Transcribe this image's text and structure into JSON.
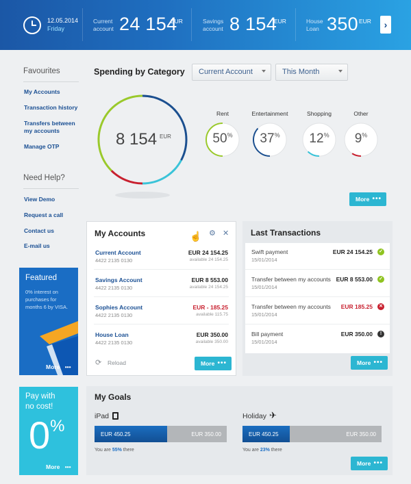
{
  "header": {
    "date": "12.05.2014",
    "day": "Friday",
    "accounts": [
      {
        "label_line1": "Current",
        "label_line2": "account",
        "value": "24 154",
        "currency": "EUR"
      },
      {
        "label_line1": "Savings",
        "label_line2": "account",
        "value": "8 154",
        "currency": "EUR"
      },
      {
        "label_line1": "House",
        "label_line2": "Loan",
        "value": "350",
        "currency": "EUR"
      }
    ],
    "next_icon": "chevron-right-icon"
  },
  "sidebar": {
    "favourites_title": "Favourites",
    "favourites": [
      "My Accounts",
      "Transaction history",
      "Transfers between",
      "my accounts",
      "Manage OTP"
    ],
    "help_title": "Need Help?",
    "help": [
      "View Demo",
      "Request a call",
      "Contact us",
      "E-mail us"
    ]
  },
  "featured": {
    "title": "Featured",
    "text": [
      "0% interest on",
      "purchases for",
      "months 6 by VISA."
    ],
    "more": "More",
    "dots": "•••"
  },
  "payfree": {
    "title_line1": "Pay with",
    "title_line2": "no cost!",
    "big": "0",
    "pct": "%",
    "more": "More",
    "dots": "•••"
  },
  "spending": {
    "title": "Spending by Category",
    "account_select": "Current Account",
    "period_select": "This Month",
    "total": "8 154",
    "currency": "EUR",
    "ring_colors": [
      "#1b4f8f",
      "#3ac3d8",
      "#c8202f",
      "#9ac92b"
    ],
    "categories": [
      {
        "label": "Rent",
        "pct": "50",
        "sign": "%",
        "color": "#9ac92b",
        "fraction": 0.5
      },
      {
        "label": "Entertainment",
        "pct": "37",
        "sign": "%",
        "color": "#1b4f8f",
        "fraction": 0.37
      },
      {
        "label": "Shopping",
        "pct": "12",
        "sign": "%",
        "color": "#3ac3d8",
        "fraction": 0.12
      },
      {
        "label": "Other",
        "pct": "9",
        "sign": "%",
        "color": "#c8202f",
        "fraction": 0.09
      }
    ],
    "more": "More",
    "dots": "•••"
  },
  "my_accounts": {
    "title": "My Accounts",
    "rows": [
      {
        "name": "Current Account",
        "number": "4422 2135 0130",
        "amount": "EUR 24 154.25",
        "available": "available 24 154.25",
        "negative": false
      },
      {
        "name": "Savings Account",
        "number": "4422 2135 0130",
        "amount": "EUR 8 553.00",
        "available": "available 24 154.25",
        "negative": false
      },
      {
        "name": "Sophies Account",
        "number": "4422 2135 0130",
        "amount": "EUR - 185.25",
        "available": "available 115.75",
        "negative": true
      },
      {
        "name": "House Loan",
        "number": "4422 2135 0130",
        "amount": "EUR 350.00",
        "available": "available 350.00",
        "negative": false
      }
    ],
    "reload": "Reload",
    "more": "More",
    "dots": "•••"
  },
  "transactions": {
    "title": "Last Transactions",
    "rows": [
      {
        "name": "Swift payment",
        "date": "15/01/2014",
        "amount": "EUR 24 154.25",
        "status": "ok",
        "negative": false
      },
      {
        "name": "Transfer between my accounts",
        "date": "15/01/2014",
        "amount": "EUR 8 553.00",
        "status": "ok",
        "negative": false
      },
      {
        "name": "Transfer between my accounts",
        "date": "15/01/2014",
        "amount": "EUR 185.25",
        "status": "error",
        "negative": true
      },
      {
        "name": "Bill payment",
        "date": "15/01/2014",
        "amount": "EUR 350.00",
        "status": "info",
        "negative": false
      }
    ],
    "status_glyphs": {
      "ok": "✓",
      "error": "✕",
      "info": "!"
    },
    "status_colors": {
      "ok": "#8fc320",
      "error": "#c8202f",
      "info": "#333333"
    },
    "more": "More",
    "dots": "•••"
  },
  "goals": {
    "title": "My Goals",
    "items": [
      {
        "name": "iPad",
        "saved": "EUR 450.25",
        "target": "EUR 350.00",
        "pct_text": "55%",
        "prefix": "You are",
        "suffix": "there",
        "fraction": 0.55
      },
      {
        "name": "Holiday",
        "saved": "EUR 450.25",
        "target": "EUR 350.00",
        "pct_text": "23%",
        "prefix": "You are",
        "suffix": "there",
        "fraction": 0.34
      }
    ],
    "more": "More",
    "dots": "•••"
  }
}
